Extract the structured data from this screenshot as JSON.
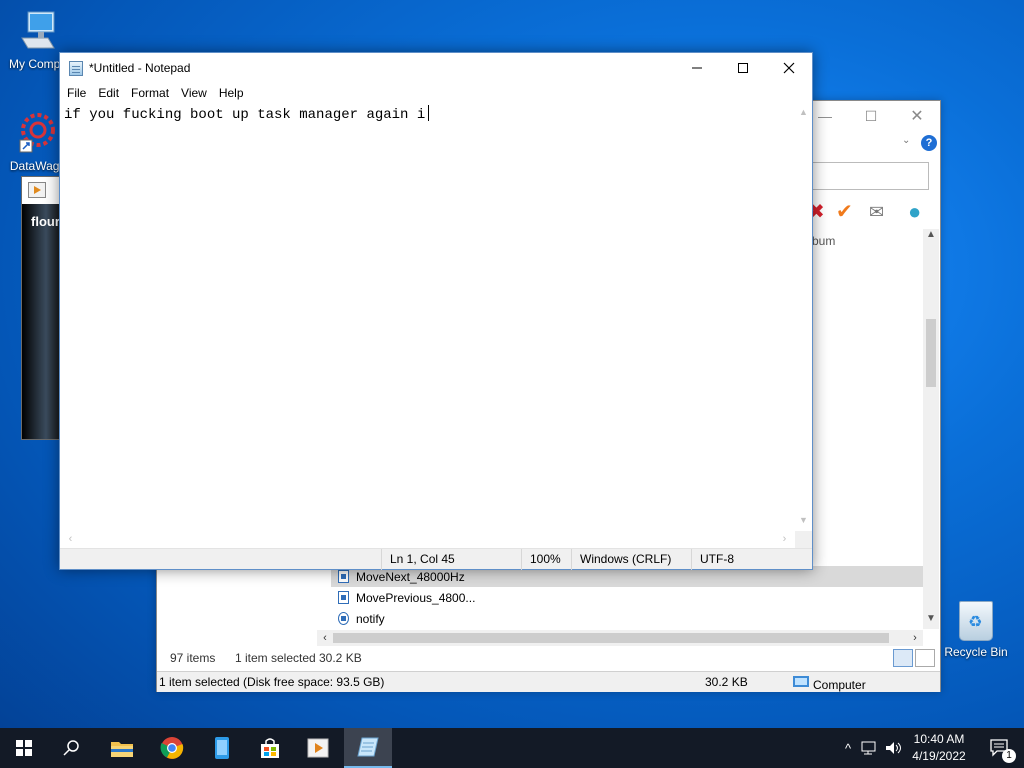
{
  "desktop": {
    "icons": [
      {
        "label": "My Compu",
        "icon": "computer-icon"
      },
      {
        "label": "DataWago",
        "icon": "gear-shortcut-icon"
      },
      {
        "label": "Recycle Bin",
        "icon": "recycle-bin-icon"
      }
    ]
  },
  "player_window": {
    "text": "flouri"
  },
  "explorer": {
    "column_header": "bum",
    "rows": [
      {
        "name": "MoveNext_48000Hz",
        "icon": "audio-file-icon",
        "selected": true
      },
      {
        "name": "MovePrevious_4800...",
        "icon": "audio-file-icon",
        "selected": false
      },
      {
        "name": "notify",
        "icon": "settings-file-icon",
        "selected": false
      }
    ],
    "status_items": "97 items",
    "status_selected": "1 item selected",
    "status_size": "30.2 KB",
    "bottom_status": "1 item selected (Disk free space: 93.5 GB)",
    "bottom_size": "30.2 KB",
    "bottom_location": "Computer"
  },
  "notepad": {
    "title": "*Untitled - Notepad",
    "menu": [
      "File",
      "Edit",
      "Format",
      "View",
      "Help"
    ],
    "content": "if you fucking boot up task manager again i",
    "status": {
      "position": "Ln 1, Col 45",
      "zoom": "100%",
      "line_ending": "Windows (CRLF)",
      "encoding": "UTF-8"
    }
  },
  "taskbar": {
    "pinned": [
      "start-button",
      "search-button",
      "file-explorer",
      "chrome",
      "phone-app",
      "store",
      "media-player",
      "notepad"
    ],
    "time": "10:40 AM",
    "date": "4/19/2022",
    "notification_count": "1"
  }
}
